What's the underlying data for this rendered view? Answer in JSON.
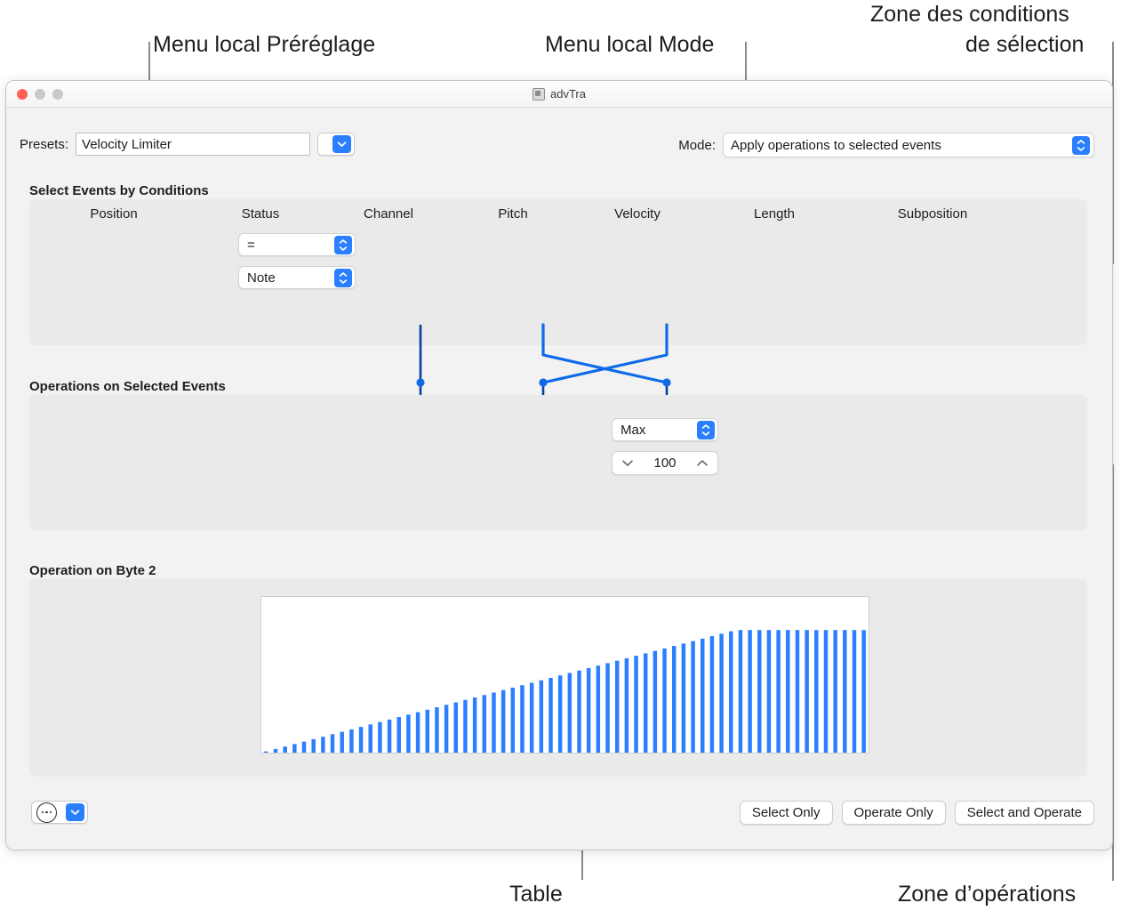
{
  "annotations": {
    "preset_menu": "Menu local Préréglage",
    "mode_menu": "Menu local Mode",
    "conditions_zone_line1": "Zone des conditions",
    "conditions_zone_line2": "de sélection",
    "table": "Table",
    "operations_zone": "Zone d’opérations"
  },
  "window": {
    "title": "advTra",
    "title_icon": "app-icon"
  },
  "toolbar": {
    "presets_label": "Presets:",
    "presets_value": "Velocity Limiter",
    "presets_popup_icon": "chevron-down-icon",
    "mode_label": "Mode:",
    "mode_value": "Apply operations to selected events",
    "mode_popup_icon": "up-down-chevron-icon"
  },
  "conditions": {
    "heading": "Select Events by Conditions",
    "columns": [
      "Position",
      "Status",
      "Channel",
      "Pitch",
      "Velocity",
      "Length",
      "Subposition"
    ],
    "status_operator": "=",
    "status_value": "Note"
  },
  "operations": {
    "heading": "Operations on Selected Events",
    "velocity_op": "Max",
    "velocity_amount": "100",
    "decrement_icon": "chevron-down-icon",
    "increment_icon": "chevron-up-icon"
  },
  "byte2": {
    "heading": "Operation on Byte 2"
  },
  "footer": {
    "more_icon": "ellipsis-circle-icon",
    "more_popup_icon": "chevron-down-icon",
    "buttons": [
      "Select Only",
      "Operate Only",
      "Select and Operate"
    ]
  },
  "colors": {
    "accent": "#2b7fff",
    "curve": "#0a6cf0",
    "panel": "#eaeaea",
    "window_bg": "#f2f2f2"
  },
  "chart_data": {
    "type": "bar",
    "title": "Operation on Byte 2",
    "xlabel": "",
    "ylabel": "",
    "ylim": [
      0,
      127
    ],
    "xlim": [
      0,
      127
    ],
    "grid": false,
    "legend": null,
    "note": "Velocity Limiter transfer curve: output = min(input, 100), rendered as 64 sampled bars",
    "categories": [
      1,
      3,
      5,
      7,
      9,
      11,
      13,
      15,
      17,
      19,
      21,
      23,
      25,
      27,
      29,
      31,
      33,
      35,
      37,
      39,
      41,
      43,
      45,
      47,
      49,
      51,
      53,
      55,
      57,
      59,
      61,
      63,
      65,
      67,
      69,
      71,
      73,
      75,
      77,
      79,
      81,
      83,
      85,
      87,
      89,
      91,
      93,
      95,
      97,
      99,
      101,
      103,
      105,
      107,
      109,
      111,
      113,
      115,
      117,
      119,
      121,
      123,
      125,
      127
    ],
    "values": [
      1,
      3,
      5,
      7,
      9,
      11,
      13,
      15,
      17,
      19,
      21,
      23,
      25,
      27,
      29,
      31,
      33,
      35,
      37,
      39,
      41,
      43,
      45,
      47,
      49,
      51,
      53,
      55,
      57,
      59,
      61,
      63,
      65,
      67,
      69,
      71,
      73,
      75,
      77,
      79,
      81,
      83,
      85,
      87,
      89,
      91,
      93,
      95,
      97,
      99,
      100,
      100,
      100,
      100,
      100,
      100,
      100,
      100,
      100,
      100,
      100,
      100,
      100,
      100
    ]
  }
}
